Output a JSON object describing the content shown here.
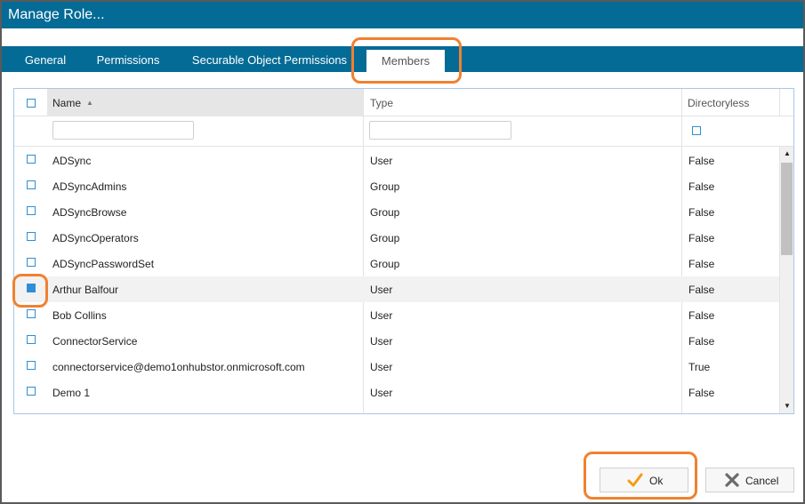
{
  "window": {
    "title": "Manage Role..."
  },
  "tabs": [
    {
      "label": "General"
    },
    {
      "label": "Permissions"
    },
    {
      "label": "Securable Object Permissions"
    },
    {
      "label": "Members"
    }
  ],
  "active_tab": "Members",
  "grid": {
    "columns": {
      "name": "Name",
      "type": "Type",
      "directoryless": "Directoryless"
    },
    "sort": {
      "column": "Name",
      "direction": "ascending",
      "indicator": "▲"
    },
    "filters": {
      "name": "",
      "type": "",
      "directoryless_checked": false
    },
    "rows": [
      {
        "name": "ADSync",
        "type": "User",
        "directoryless": "False",
        "checked": false
      },
      {
        "name": "ADSyncAdmins",
        "type": "Group",
        "directoryless": "False",
        "checked": false
      },
      {
        "name": "ADSyncBrowse",
        "type": "Group",
        "directoryless": "False",
        "checked": false
      },
      {
        "name": "ADSyncOperators",
        "type": "Group",
        "directoryless": "False",
        "checked": false
      },
      {
        "name": "ADSyncPasswordSet",
        "type": "Group",
        "directoryless": "False",
        "checked": false
      },
      {
        "name": "Arthur Balfour",
        "type": "User",
        "directoryless": "False",
        "checked": true
      },
      {
        "name": "Bob Collins",
        "type": "User",
        "directoryless": "False",
        "checked": false
      },
      {
        "name": "ConnectorService",
        "type": "User",
        "directoryless": "False",
        "checked": false
      },
      {
        "name": "connectorservice@demo1onhubstor.onmicrosoft.com",
        "type": "User",
        "directoryless": "True",
        "checked": false
      },
      {
        "name": "Demo 1",
        "type": "User",
        "directoryless": "False",
        "checked": false
      }
    ]
  },
  "buttons": {
    "ok": "Ok",
    "cancel": "Cancel"
  },
  "icons": {
    "ok": "checkmark-icon",
    "cancel": "x-icon",
    "scroll_up": "scroll-up-arrow-icon",
    "scroll_down": "scroll-down-arrow-icon"
  },
  "colors": {
    "titlebar": "#036b96",
    "highlight": "#f08130",
    "checkbox": "#2e8fd6",
    "ok_check": "#f39c12"
  }
}
